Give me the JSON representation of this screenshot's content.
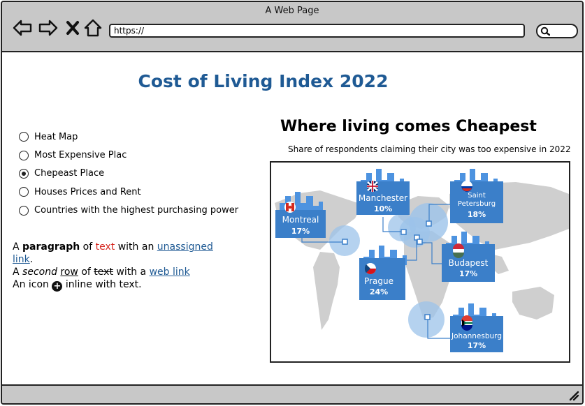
{
  "window": {
    "title": "A Web Page"
  },
  "toolbar": {
    "url": "https://",
    "icons": [
      "back-icon",
      "forward-icon",
      "close-icon",
      "home-icon",
      "search-icon"
    ]
  },
  "page": {
    "title": "Cost of Living Index 2022"
  },
  "menu": {
    "items": [
      {
        "label": "Heat Map",
        "selected": false
      },
      {
        "label": "Most Expensive Plac",
        "selected": false
      },
      {
        "label": "Chepeast Place",
        "selected": true
      },
      {
        "label": "Houses Prices and Rent",
        "selected": false
      },
      {
        "label": "Countries with the highest purchasing power",
        "selected": false
      }
    ]
  },
  "paragraph": {
    "l1_a": "A ",
    "l1_bold": "paragraph",
    "l1_b": " of ",
    "l1_red": "text",
    "l1_c": " with an ",
    "l1_link": "unassigned link",
    "l1_d": ".",
    "l2_a": "A ",
    "l2_italic": "second",
    "l2_b": " ",
    "l2_under": "row",
    "l2_c": " of ",
    "l2_strike": "text",
    "l2_d": " with a ",
    "l2_link": "web link",
    "l3_a": "An icon ",
    "l3_icon": "plus-circle-icon",
    "l3_b": " inline with text."
  },
  "map": {
    "title": "Where living comes Cheapest",
    "subtitle": "Share of respondents claiming their city was too expensive in 2022",
    "cities": [
      {
        "name": "Montreal",
        "value": "17%",
        "flag": "canada-flag-icon"
      },
      {
        "name": "Manchester",
        "value": "10%",
        "flag": "uk-flag-icon"
      },
      {
        "name": "Saint Petersburg",
        "value": "18%",
        "flag": "russia-flag-icon"
      },
      {
        "name": "Budapest",
        "value": "17%",
        "flag": "hungary-flag-icon"
      },
      {
        "name": "Prague",
        "value": "24%",
        "flag": "czech-flag-icon"
      },
      {
        "name": "Johannesburg",
        "value": "17%",
        "flag": "south-africa-flag-icon"
      }
    ],
    "colors": {
      "card": "#3b7fc9",
      "skyline": "#4d93e0",
      "land": "#cfcfcf",
      "halo": "#9cc3ea"
    }
  }
}
